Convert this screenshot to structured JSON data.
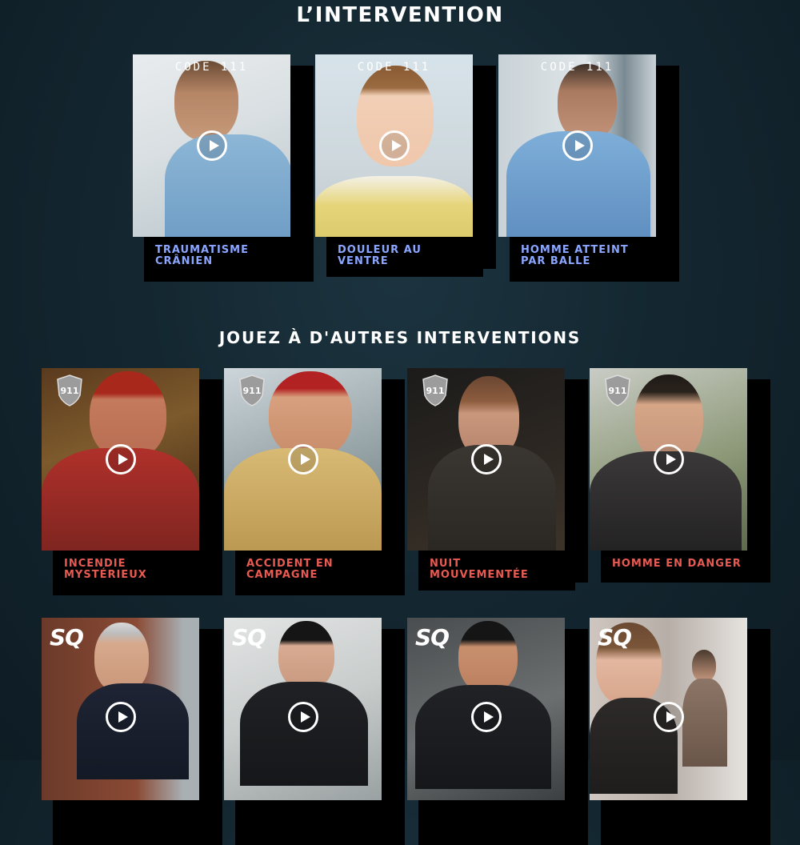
{
  "section1": {
    "title": "L’INTERVENTION",
    "badge": "CODE 111",
    "cards": [
      {
        "label": "TRAUMATISME CRÂNIEN"
      },
      {
        "label": "DOULEUR AU VENTRE"
      },
      {
        "label": "HOMME ATTEINT PAR BALLE"
      }
    ]
  },
  "section2": {
    "title": "JOUEZ À D'AUTRES INTERVENTIONS",
    "badge_911": "911",
    "badge_sq": "SQ",
    "cards_row1": [
      {
        "label": "INCENDIE MYSTÉRIEUX"
      },
      {
        "label": "ACCIDENT EN CAMPAGNE"
      },
      {
        "label": "NUIT MOUVEMENTÉE"
      },
      {
        "label": "HOMME EN DANGER"
      }
    ]
  },
  "colors": {
    "label_blue": "#8aa6ff",
    "label_red": "#e85a52",
    "background": "#142731"
  },
  "icons": [
    "play-icon",
    "shield-911-icon",
    "sq-logo"
  ]
}
